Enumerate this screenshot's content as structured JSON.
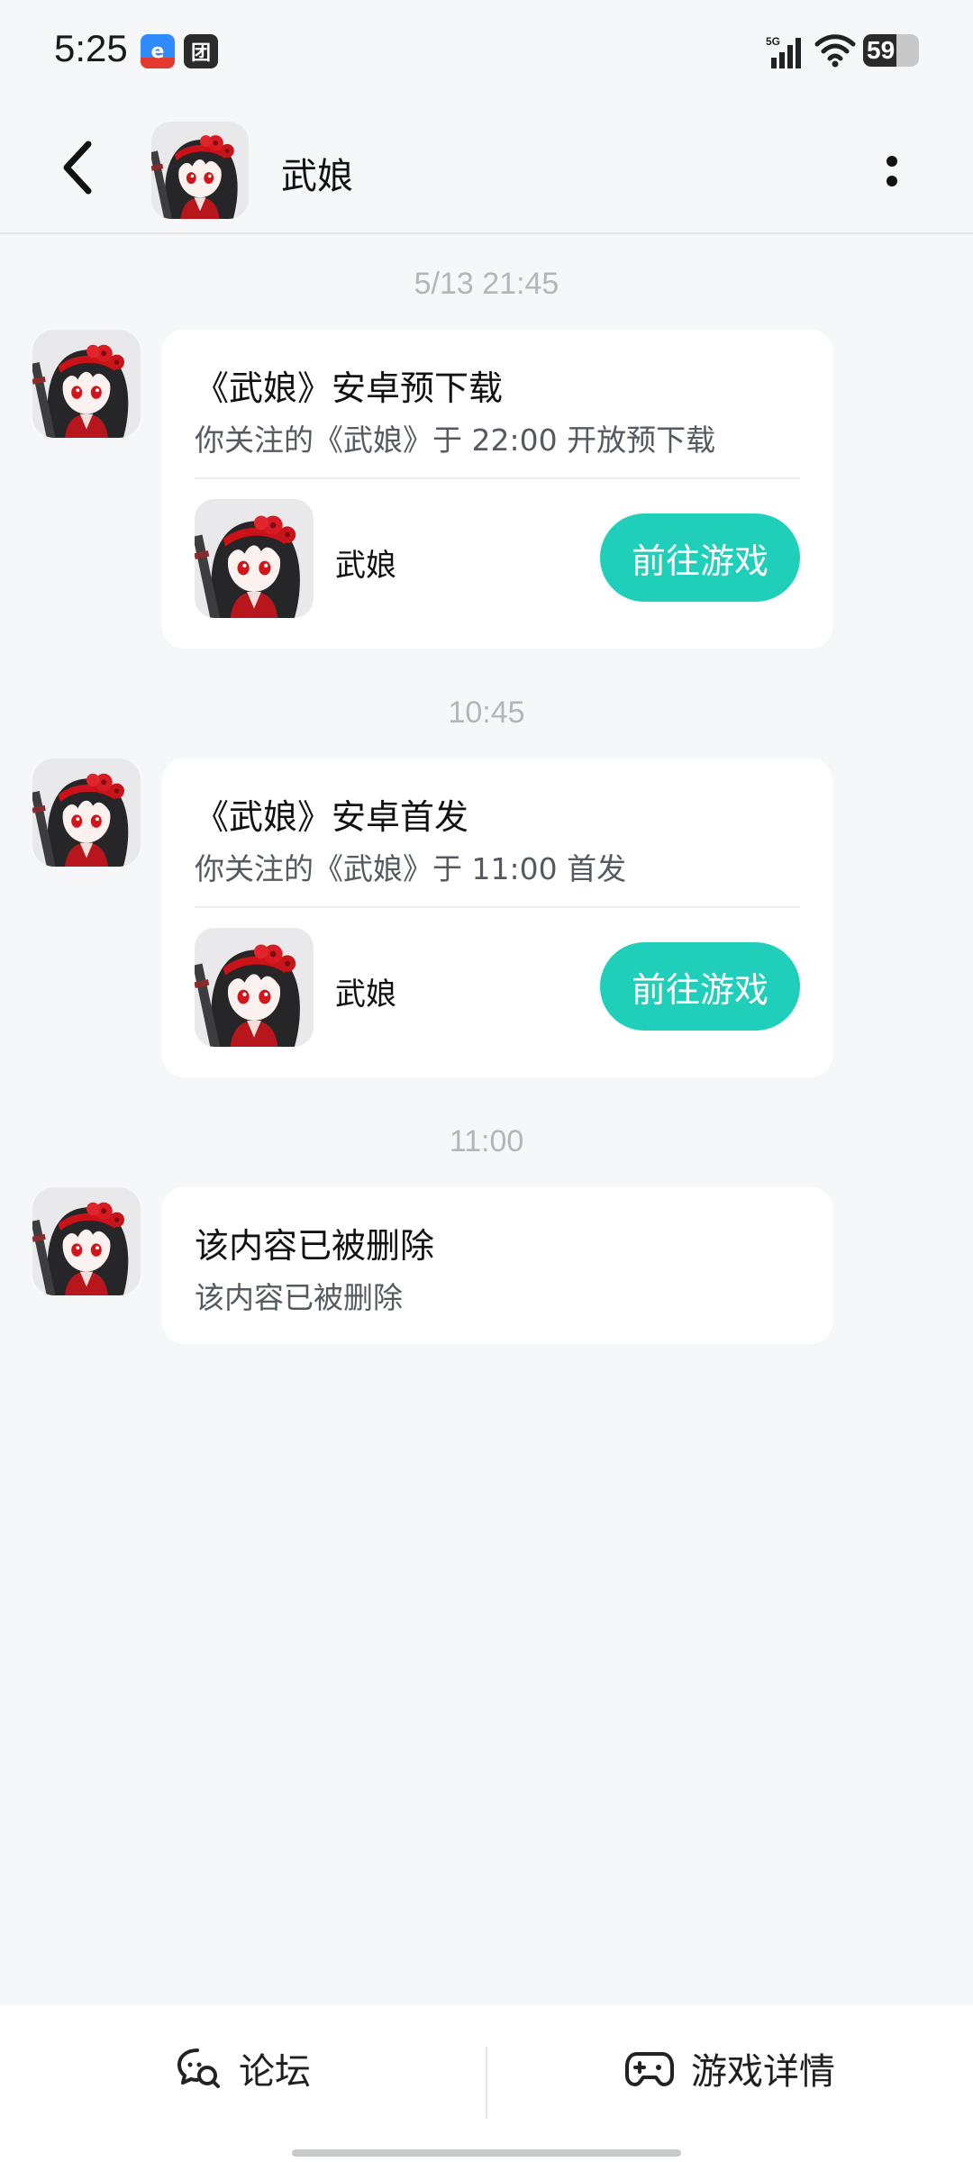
{
  "status_bar": {
    "time": "5:25",
    "notification_icons": [
      "e-app-icon",
      "tuan-icon"
    ],
    "tuan_glyph": "团",
    "network": "5G",
    "battery_level": "59",
    "battery_fraction": 0.59
  },
  "header": {
    "title": "武娘",
    "avatar": "game-avatar-icon"
  },
  "messages": [
    {
      "timestamp": "5/13  21:45",
      "title": "《武娘》安卓预下载",
      "subtitle": "你关注的《武娘》于 22:00 开放预下载",
      "game_name": "武娘",
      "button_label": "前往游戏"
    },
    {
      "timestamp": "10:45",
      "title": "《武娘》安卓首发",
      "subtitle": "你关注的《武娘》于 11:00 首发",
      "game_name": "武娘",
      "button_label": "前往游戏"
    },
    {
      "timestamp": "11:00",
      "title": "该内容已被删除",
      "subtitle": "该内容已被删除"
    }
  ],
  "bottom_bar": {
    "forum_label": "论坛",
    "forum_icon": "chat-bubble-icon",
    "details_label": "游戏详情",
    "details_icon": "gamepad-icon"
  },
  "colors": {
    "accent": "#1fcfba",
    "background": "#f6f7f9",
    "timestamp": "#b3b6bb"
  }
}
